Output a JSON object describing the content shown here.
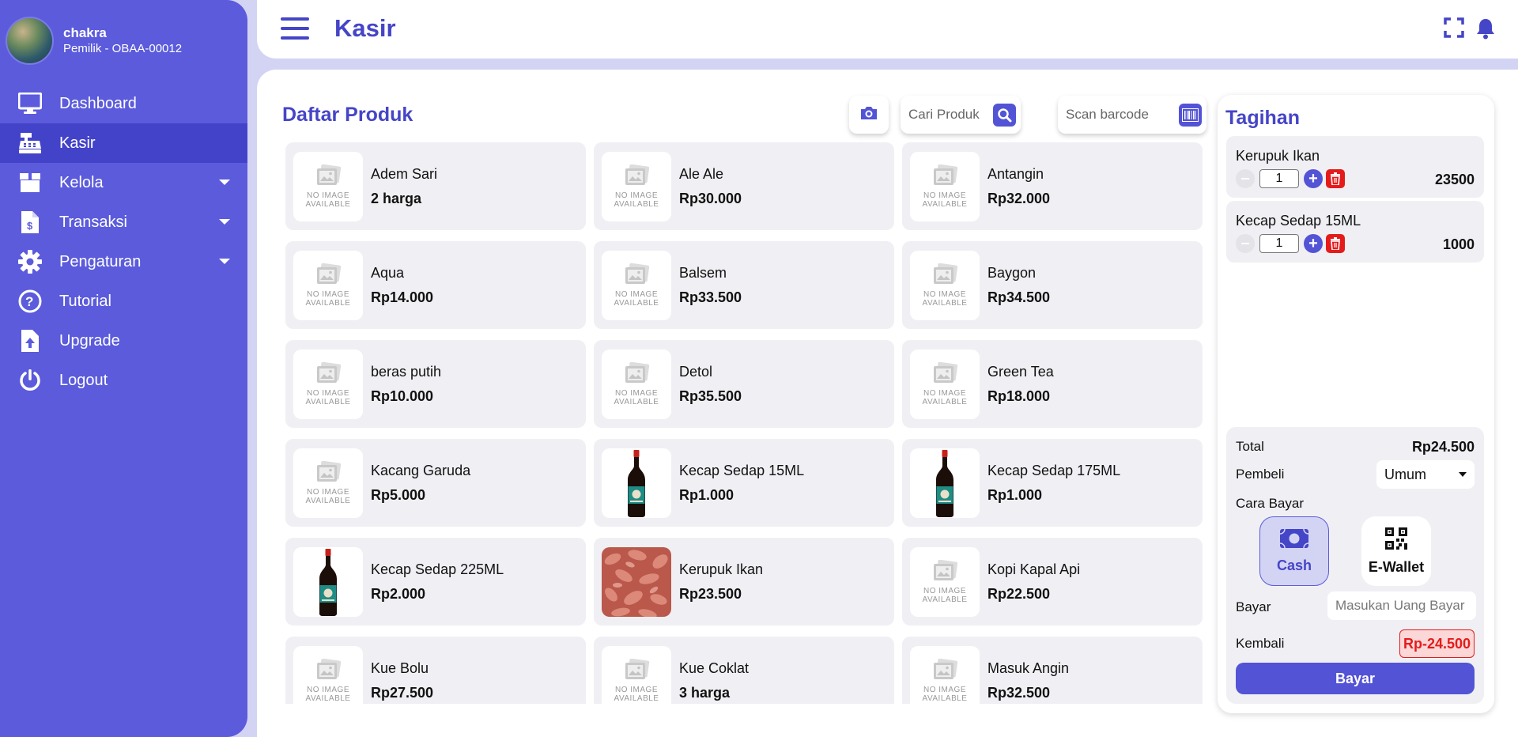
{
  "colors": {
    "accent": "#5b5bdc",
    "accent_dark": "#4545c7",
    "danger": "#e51b1b",
    "card_bg": "#f0f0f4"
  },
  "user": {
    "name": "chakra",
    "role": "Pemilik - OBAA-00012"
  },
  "sidebar": {
    "items": [
      {
        "label": "Dashboard",
        "icon": "monitor-icon"
      },
      {
        "label": "Kasir",
        "icon": "cash-register-icon",
        "active": true
      },
      {
        "label": "Kelola",
        "icon": "box-icon",
        "dropdown": true
      },
      {
        "label": "Transaksi",
        "icon": "invoice-icon",
        "dropdown": true
      },
      {
        "label": "Pengaturan",
        "icon": "gear-icon",
        "dropdown": true
      },
      {
        "label": "Tutorial",
        "icon": "question-icon"
      },
      {
        "label": "Upgrade",
        "icon": "upload-icon"
      },
      {
        "label": "Logout",
        "icon": "power-icon"
      }
    ]
  },
  "header": {
    "title": "Kasir"
  },
  "products": {
    "title": "Daftar Produk",
    "search_placeholder": "Cari Produk",
    "scan_placeholder": "Scan barcode",
    "no_image_line1": "NO IMAGE",
    "no_image_line2": "AVAILABLE",
    "items": [
      {
        "name": "Adem Sari",
        "price": "2 harga",
        "image": "none"
      },
      {
        "name": "Ale Ale",
        "price": "Rp30.000",
        "image": "none"
      },
      {
        "name": "Antangin",
        "price": "Rp32.000",
        "image": "none"
      },
      {
        "name": "Aqua",
        "price": "Rp14.000",
        "image": "none"
      },
      {
        "name": "Balsem",
        "price": "Rp33.500",
        "image": "none"
      },
      {
        "name": "Baygon",
        "price": "Rp34.500",
        "image": "none"
      },
      {
        "name": "beras putih",
        "price": "Rp10.000",
        "image": "none"
      },
      {
        "name": "Detol",
        "price": "Rp35.500",
        "image": "none"
      },
      {
        "name": "Green Tea",
        "price": "Rp18.000",
        "image": "none"
      },
      {
        "name": "Kacang Garuda",
        "price": "Rp5.000",
        "image": "none"
      },
      {
        "name": "Kecap Sedap 15ML",
        "price": "Rp1.000",
        "image": "bottle"
      },
      {
        "name": "Kecap Sedap 175ML",
        "price": "Rp1.000",
        "image": "bottle"
      },
      {
        "name": "Kecap Sedap 225ML",
        "price": "Rp2.000",
        "image": "bottle"
      },
      {
        "name": "Kerupuk Ikan",
        "price": "Rp23.500",
        "image": "crackers"
      },
      {
        "name": "Kopi Kapal Api",
        "price": "Rp22.500",
        "image": "none"
      },
      {
        "name": "Kue Bolu",
        "price": "Rp27.500",
        "image": "none"
      },
      {
        "name": "Kue Coklat",
        "price": "3 harga",
        "image": "none"
      },
      {
        "name": "Masuk Angin",
        "price": "Rp32.500",
        "image": "none"
      }
    ]
  },
  "bill": {
    "title": "Tagihan",
    "items": [
      {
        "name": "Kerupuk Ikan",
        "qty": "1",
        "total": "23500"
      },
      {
        "name": "Kecap Sedap 15ML",
        "qty": "1",
        "total": "1000"
      }
    ],
    "total_label": "Total",
    "total_value": "Rp24.500",
    "buyer_label": "Pembeli",
    "buyer_value": "Umum",
    "method_label": "Cara Bayar",
    "methods": [
      {
        "label": "Cash",
        "selected": true
      },
      {
        "label": "E-Wallet",
        "selected": false
      }
    ],
    "pay_label": "Bayar",
    "pay_placeholder": "Masukan Uang Bayar",
    "change_label": "Kembali",
    "change_value": "Rp-24.500",
    "submit_label": "Bayar"
  }
}
